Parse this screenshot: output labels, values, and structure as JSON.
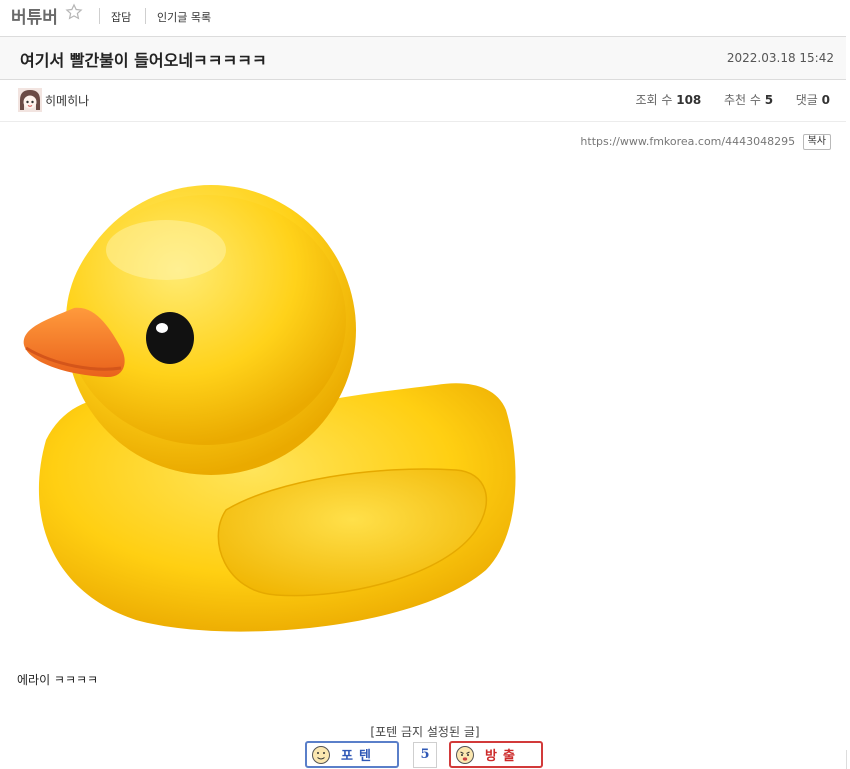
{
  "board": {
    "name": "버튜버"
  },
  "nav": {
    "link1": "잡담",
    "link2": "인기글 목록"
  },
  "post": {
    "title": "여기서 빨간불이 들어오네ㅋㅋㅋㅋㅋ",
    "date": "2022.03.18 15:42",
    "author": "히메히나",
    "stats": {
      "views_label": "조회 수",
      "views": "108",
      "recommend_label": "추천 수",
      "recommend": "5",
      "comments_label": "댓글",
      "comments": "0"
    },
    "url": "https://www.fmkorea.com/4443048295",
    "copy_label": "복사",
    "body_text": "에라이 ㅋㅋㅋㅋ"
  },
  "vote": {
    "note": "[포텐 금지 설정된 글]",
    "up_label": "포텐",
    "count": "5",
    "down_label": "방출"
  },
  "colors": {
    "title_bg": "#f8f8f8",
    "vote_up": "#2f58b6",
    "vote_down": "#cc2a2a",
    "duck": "#ffd21a"
  }
}
